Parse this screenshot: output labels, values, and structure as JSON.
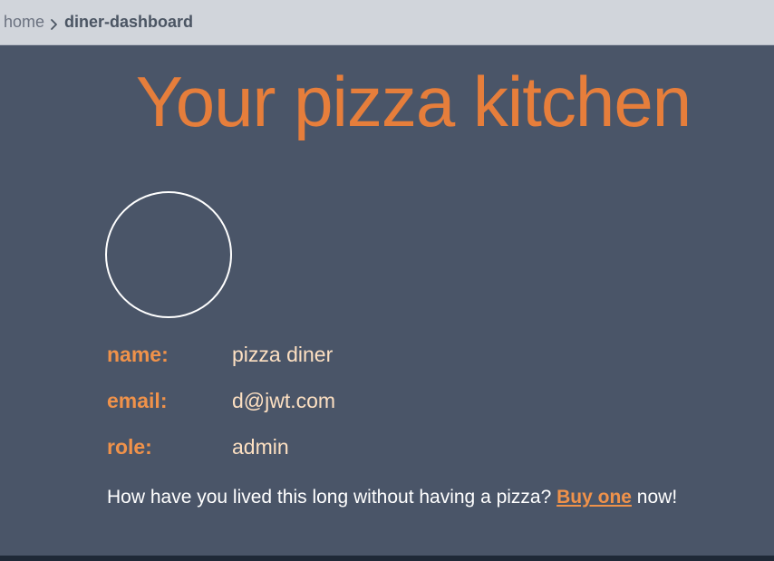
{
  "breadcrumb": {
    "home": "home",
    "current": "diner-dashboard"
  },
  "page": {
    "title": "Your pizza kitchen"
  },
  "profile": {
    "name_label": "name:",
    "name_value": "pizza diner",
    "email_label": "email:",
    "email_value": "d@jwt.com",
    "role_label": "role:",
    "role_value": "admin"
  },
  "message": {
    "before": "How have you lived this long without having a pizza? ",
    "link": "Buy one",
    "after": " now!"
  },
  "colors": {
    "accent": "#e67e3b",
    "label": "#f0924a",
    "value": "#fde0c2",
    "background": "#4a5568",
    "breadcrumb_bar": "#d1d5db"
  }
}
